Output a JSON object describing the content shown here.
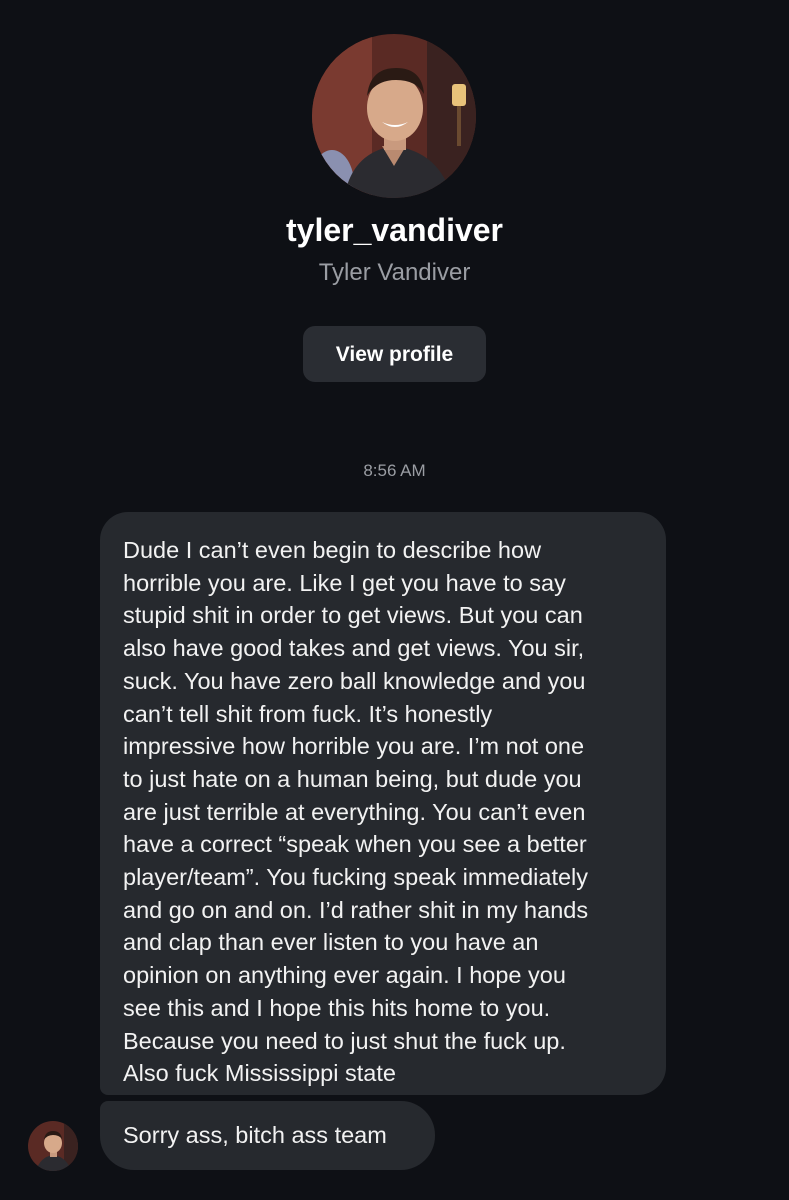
{
  "profile": {
    "username": "tyler_vandiver",
    "full_name": "Tyler Vandiver",
    "view_profile_label": "View profile"
  },
  "conversation": {
    "timestamp": "8:56 AM",
    "messages": [
      {
        "lines": [
          "Dude I can’t even begin to describe how",
          "horrible you are. Like I get you have to say",
          "stupid shit in order to get views. But you can",
          "also have good takes and get views. You sir,",
          "suck. You have zero ball knowledge and you",
          "can’t tell shit from fuck. It’s honestly",
          "impressive how horrible you are. I’m not one",
          "to just hate on a human being, but dude you",
          "are just terrible at everything. You can’t even",
          "have a correct “speak when you see a better",
          "player/team”. You fucking speak immediately",
          "and go on and on. I’d rather shit in my hands",
          "and clap than ever listen to you have an",
          "opinion on anything ever again. I hope you",
          "see this and I hope this hits home to you.",
          "Because you need to just shut the fuck up.",
          "Also fuck Mississippi state"
        ]
      },
      {
        "text": "Sorry ass, bitch ass team"
      }
    ]
  },
  "colors": {
    "background": "#0e1015",
    "bubble": "#26292e",
    "button": "#2a2d33",
    "secondary_text": "#9a9da3"
  }
}
